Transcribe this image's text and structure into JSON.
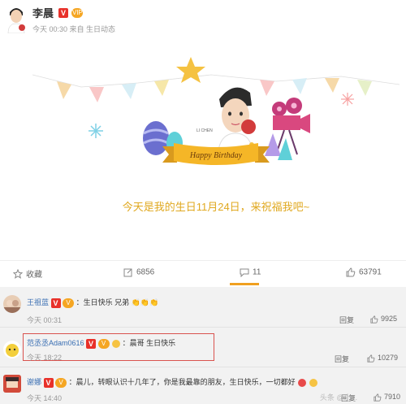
{
  "post": {
    "author": "李晨",
    "verified_badge": "V",
    "vip_badge": "VIP",
    "time": "今天 00:30",
    "source": "来自 生日动态"
  },
  "card": {
    "caption": "今天是我的生日11月24日，来祝福我吧~",
    "banner_text": "Happy Birthday",
    "cartoon_tag": "LI CHEN"
  },
  "actions": {
    "favorite_label": "收藏",
    "repost_count": "6856",
    "comment_count": "11",
    "like_count": "63791"
  },
  "comments": [
    {
      "user": "王祖蓝",
      "text": "：生日快乐 兄弟",
      "time": "今天 00:31",
      "reply": "回复",
      "likes": "9925"
    },
    {
      "user": "范丞丞Adam0616",
      "text": "：晨哥 生日快乐",
      "time": "今天 18:22",
      "reply": "回复",
      "likes": "10279"
    },
    {
      "user": "谢娜",
      "text": "：晨儿，转眼认识十几年了，你是我最靠的朋友，生日快乐，一切都好",
      "time": "今天 14:40",
      "reply": "回复",
      "likes": "7910"
    }
  ],
  "watermark": "头条 @小...",
  "colors": {
    "accent": "#f0a020",
    "username": "#3a6fb3",
    "verified": "#e8312a",
    "caption": "#e0a81f",
    "highlight": "#d9534f"
  }
}
